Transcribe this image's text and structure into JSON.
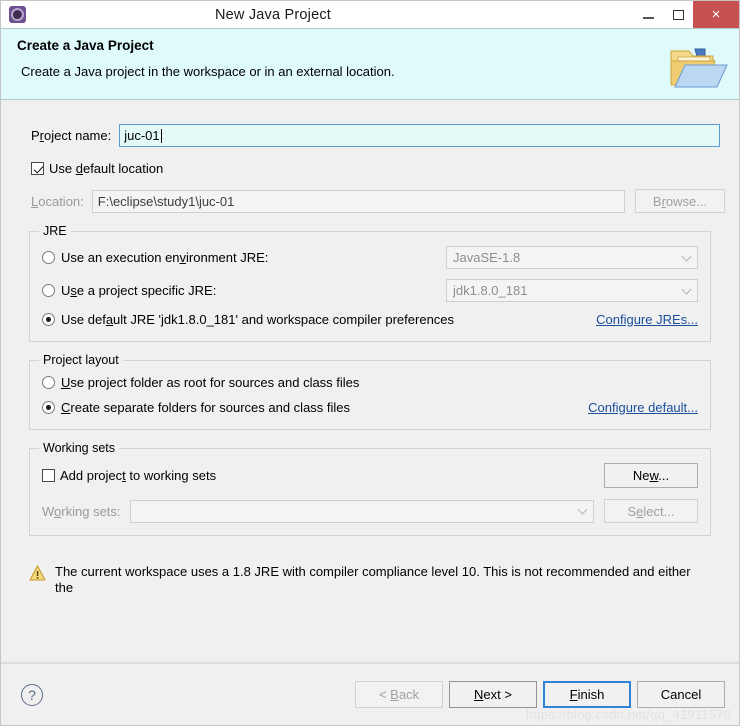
{
  "window": {
    "title": "New Java Project",
    "app_icon": "gear-icon",
    "minimize_label": "Minimize",
    "maximize_label": "Maximize",
    "close_label": "×"
  },
  "header": {
    "title": "Create a Java Project",
    "description": "Create a Java project in the workspace or in an external location.",
    "icon": "java-project-folder-icon",
    "background": "#defafa"
  },
  "form": {
    "project_name_label": "Project name:",
    "project_name_value": "juc-01",
    "use_default_location_label": "Use default location",
    "use_default_location_checked": true,
    "location_label": "Location:",
    "location_value": "F:\\eclipse\\study1\\juc-01",
    "browse_label": "Browse..."
  },
  "jre": {
    "legend": "JRE",
    "options": [
      {
        "label": "Use an execution environment JRE:",
        "selected": false,
        "combo_value": "JavaSE-1.8"
      },
      {
        "label": "Use a project specific JRE:",
        "selected": false,
        "combo_value": "jdk1.8.0_181"
      },
      {
        "label": "Use default JRE 'jdk1.8.0_181' and workspace compiler preferences",
        "selected": true
      }
    ],
    "configure_link": "Configure JREs..."
  },
  "project_layout": {
    "legend": "Project layout",
    "options": [
      {
        "label": "Use project folder as root for sources and class files",
        "selected": false
      },
      {
        "label": "Create separate folders for sources and class files",
        "selected": true
      }
    ],
    "configure_link": "Configure default..."
  },
  "working_sets": {
    "legend": "Working sets",
    "add_checkbox_label": "Add project to working sets",
    "add_checkbox_checked": false,
    "new_button": "New...",
    "sets_label": "Working sets:",
    "sets_value": "",
    "select_button": "Select..."
  },
  "warning": {
    "icon": "warning-triangle-icon",
    "text": "The current workspace uses a 1.8 JRE with compiler compliance level 10. This is not recommended and either the"
  },
  "footer": {
    "help_icon": "?",
    "back_label": "< Back",
    "next_label": "Next >",
    "finish_label": "Finish",
    "cancel_label": "Cancel",
    "back_enabled": false,
    "watermark": "https://blog.csdn.net/qq_41911570"
  },
  "colors": {
    "accent": "#2f84d8",
    "link": "#1a4f9c",
    "close_button": "#c75050",
    "header_bg": "#defafa",
    "input_focus_bg": "#e4faf9"
  }
}
